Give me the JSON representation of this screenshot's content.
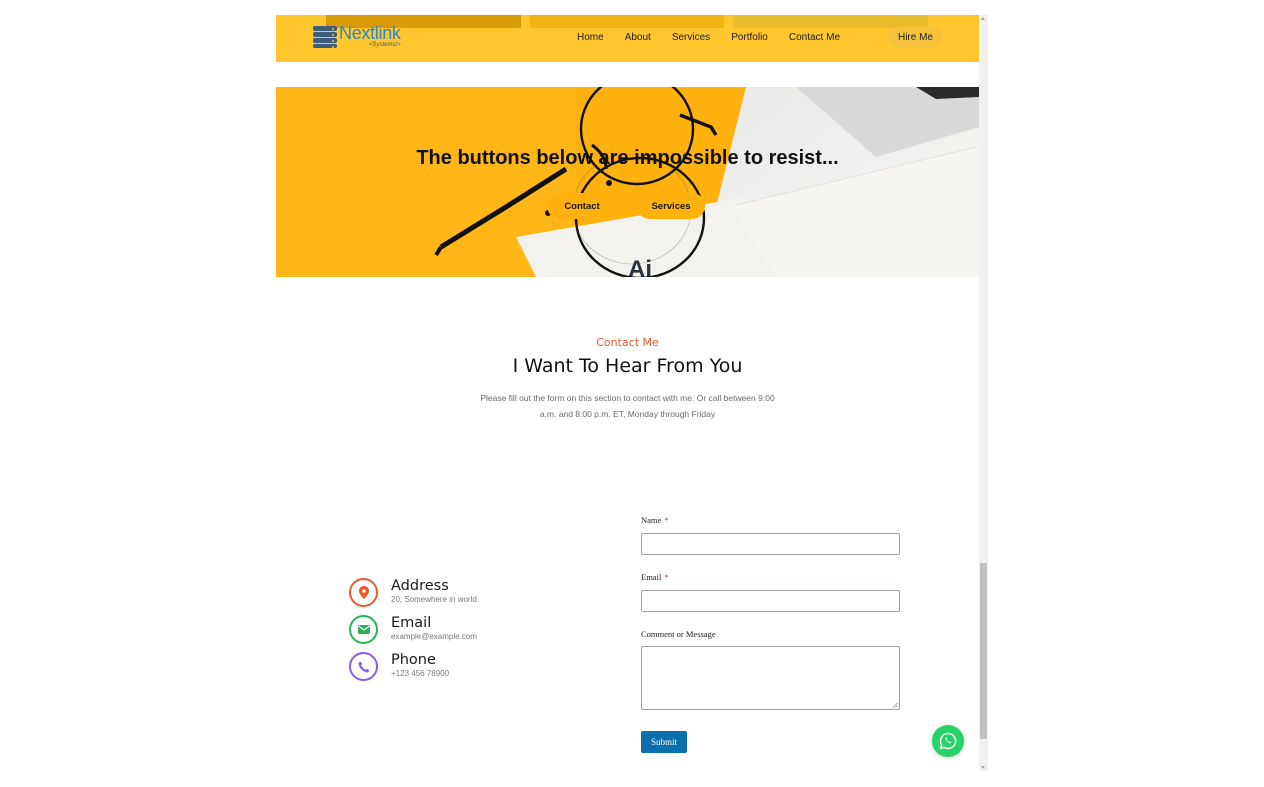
{
  "header": {
    "logo_main": "Nextlink",
    "logo_sub": "<Systems/>",
    "nav": [
      "Home",
      "About",
      "Services",
      "Portfolio",
      "Contact Me"
    ],
    "hire_label": "Hire Me"
  },
  "hero": {
    "title": "The buttons below are impossible to resist...",
    "buttons": [
      "Contact",
      "Services"
    ]
  },
  "contact": {
    "eyebrow": "Contact Me",
    "title": "I Want To Hear From You",
    "description": "Please fill out the form on this section to contact with me. Or call between 9:00 a.m. and 8:00 p.m. ET, Monday through Friday",
    "info": [
      {
        "title": "Address",
        "value": "20, Somewhere in world",
        "icon": "map-pin-icon",
        "color": "#f0582c"
      },
      {
        "title": "Email",
        "value": "example@example.com",
        "icon": "envelope-icon",
        "color": "#24b35a"
      },
      {
        "title": "Phone",
        "value": "+123 456 78900",
        "icon": "phone-icon",
        "color": "#8a5cf0"
      }
    ]
  },
  "form": {
    "name_label": "Name",
    "email_label": "Email",
    "message_label": "Comment or Message",
    "required_mark": "*",
    "name_value": "",
    "email_value": "",
    "message_value": "",
    "submit_label": "Submit"
  },
  "colors": {
    "header_bg": "#ffc62d",
    "accent": "#f0582c",
    "submit": "#0b6fad",
    "whatsapp": "#25d366"
  }
}
